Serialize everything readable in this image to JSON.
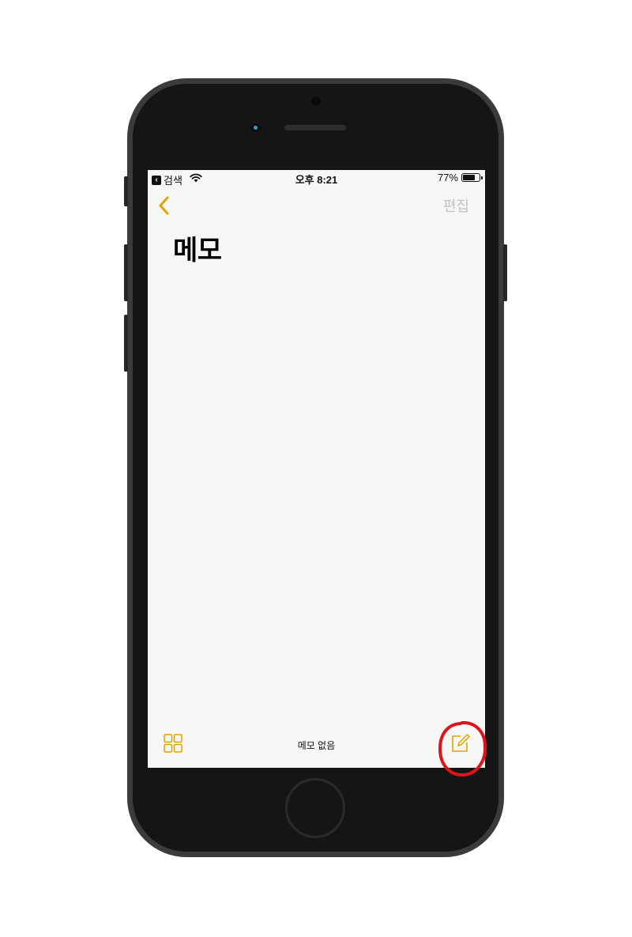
{
  "device": {
    "model": "iphone",
    "frame_color": "#151515",
    "bezel_color": "#3b3b3b"
  },
  "status_bar": {
    "back_app_label": "검색",
    "back_app_icon": "chevron-left-badge-icon",
    "wifi_icon": "wifi-icon",
    "time": "오후 8:21",
    "battery_percent_label": "77%",
    "battery_level": 0.77
  },
  "nav": {
    "back_icon": "chevron-left-icon",
    "edit_label": "편집",
    "accent_color": "#e2a300",
    "disabled_color": "#c2c2c2"
  },
  "main": {
    "title": "메모"
  },
  "toolbar": {
    "gallery_icon": "grid-gallery-icon",
    "status_text": "메모 없음",
    "compose_icon": "compose-note-icon"
  },
  "annotation": {
    "highlight_color": "#e0121a",
    "highlighted_element": "compose-button"
  }
}
